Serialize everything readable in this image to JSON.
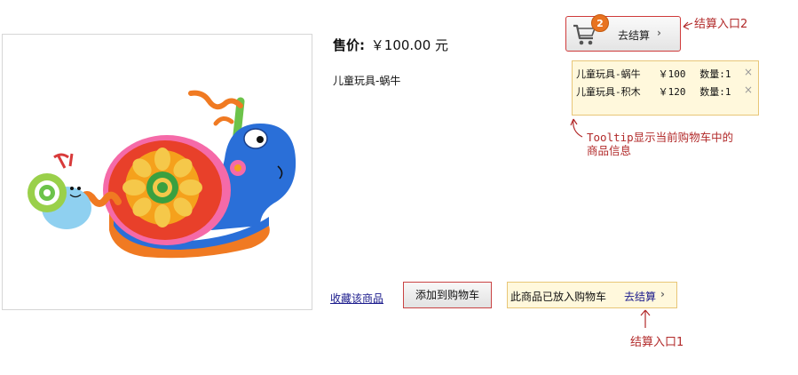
{
  "product": {
    "price_label": "售价:",
    "price_value": "￥100.00 元",
    "name": "儿童玩具-蜗牛",
    "image_icon": "snail-toy-image"
  },
  "cart": {
    "count": "2",
    "checkout_label": "去结算",
    "chevron": "›",
    "icon": "cart-icon"
  },
  "tooltip": {
    "items": [
      {
        "name": "儿童玩具-蜗牛",
        "price": "￥100",
        "qty": "数量:1",
        "remove": "×"
      },
      {
        "name": "儿童玩具-积木",
        "price": "￥120",
        "qty": "数量:1",
        "remove": "×"
      }
    ]
  },
  "annotations": {
    "entry2": "结算入口2",
    "tooltip_line1": "Tooltip显示当前购物车中的",
    "tooltip_line2": "商品信息",
    "entry1": "结算入口1"
  },
  "actions": {
    "favorite": "收藏该商品",
    "add_to_cart": "添加到购物车",
    "added_msg": "此商品已放入购物车",
    "checkout": "去结算",
    "chevron": "›"
  },
  "colors": {
    "accent_red": "#b22a2a",
    "badge_orange": "#e87320",
    "tooltip_bg": "#fff8dc",
    "link_blue": "#1a1a8c"
  }
}
